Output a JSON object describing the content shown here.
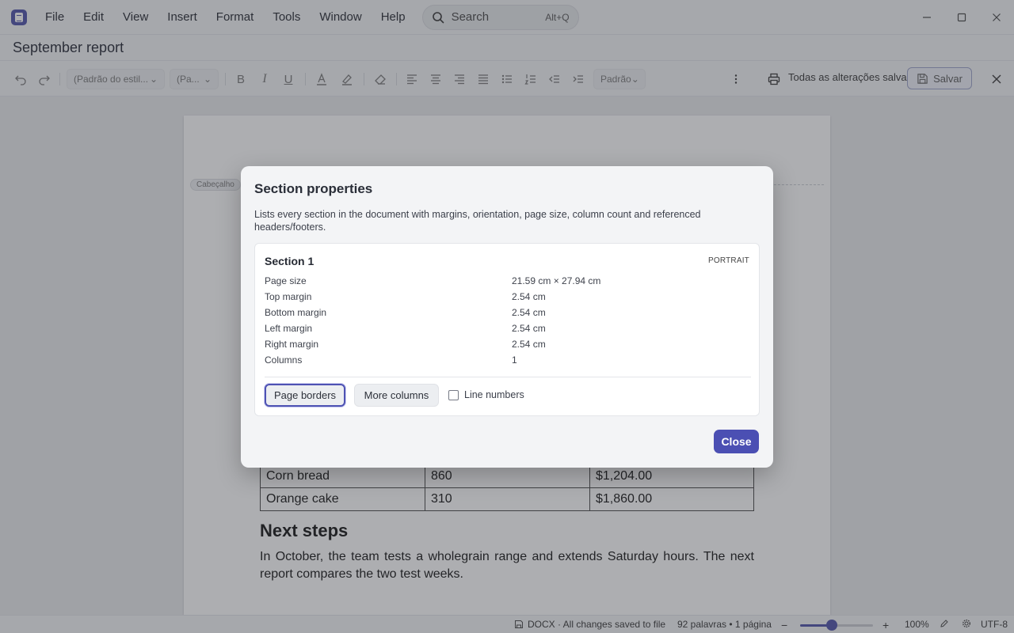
{
  "titlebar": {
    "menus": [
      "File",
      "Edit",
      "View",
      "Insert",
      "Format",
      "Tools",
      "Window",
      "Help"
    ],
    "search": {
      "label": "Search",
      "shortcut": "Alt+Q",
      "icon": "search-icon"
    },
    "window_controls": [
      "minimize-icon",
      "maximize-icon",
      "close-icon"
    ]
  },
  "document": {
    "title": "September report"
  },
  "toolbar": {
    "style_select": "(Padrão do estil...",
    "para_select": "(Pa...",
    "size_select": "Padrão",
    "saved_status": "Todas as alterações salvas",
    "save_label": "Salvar"
  },
  "page": {
    "header_tag": "Cabeçalho",
    "table_rows": [
      [
        "Corn bread",
        "860",
        "$1,204.00"
      ],
      [
        "Orange cake",
        "310",
        "$1,860.00"
      ]
    ],
    "heading": "Next steps",
    "paragraph": "In October, the team tests a wholegrain range and extends Saturday hours. The next report compares the two test weeks."
  },
  "statusbar": {
    "file_status": "DOCX · All changes saved to file",
    "counts": "92 palavras • 1 página",
    "zoom_percent": 100,
    "zoom_label": "100%",
    "zoom_slider_fraction": 0.44,
    "encoding": "UTF-8"
  },
  "dialog": {
    "title": "Section properties",
    "description": "Lists every section in the document with margins, orientation, page size, column count and referenced headers/footers.",
    "section": {
      "name": "Section 1",
      "orientation": "PORTRAIT",
      "properties": [
        {
          "label": "Page size",
          "value": "21.59 cm × 27.94 cm"
        },
        {
          "label": "Top margin",
          "value": "2.54 cm"
        },
        {
          "label": "Bottom margin",
          "value": "2.54 cm"
        },
        {
          "label": "Left margin",
          "value": "2.54 cm"
        },
        {
          "label": "Right margin",
          "value": "2.54 cm"
        },
        {
          "label": "Columns",
          "value": "1"
        }
      ]
    },
    "buttons": {
      "page_borders": "Page borders",
      "more_columns": "More columns",
      "line_numbers": "Line numbers",
      "line_numbers_checked": false,
      "close": "Close"
    }
  },
  "colors": {
    "accent": "#4b4fb3",
    "overlay": "#3c3e44"
  }
}
